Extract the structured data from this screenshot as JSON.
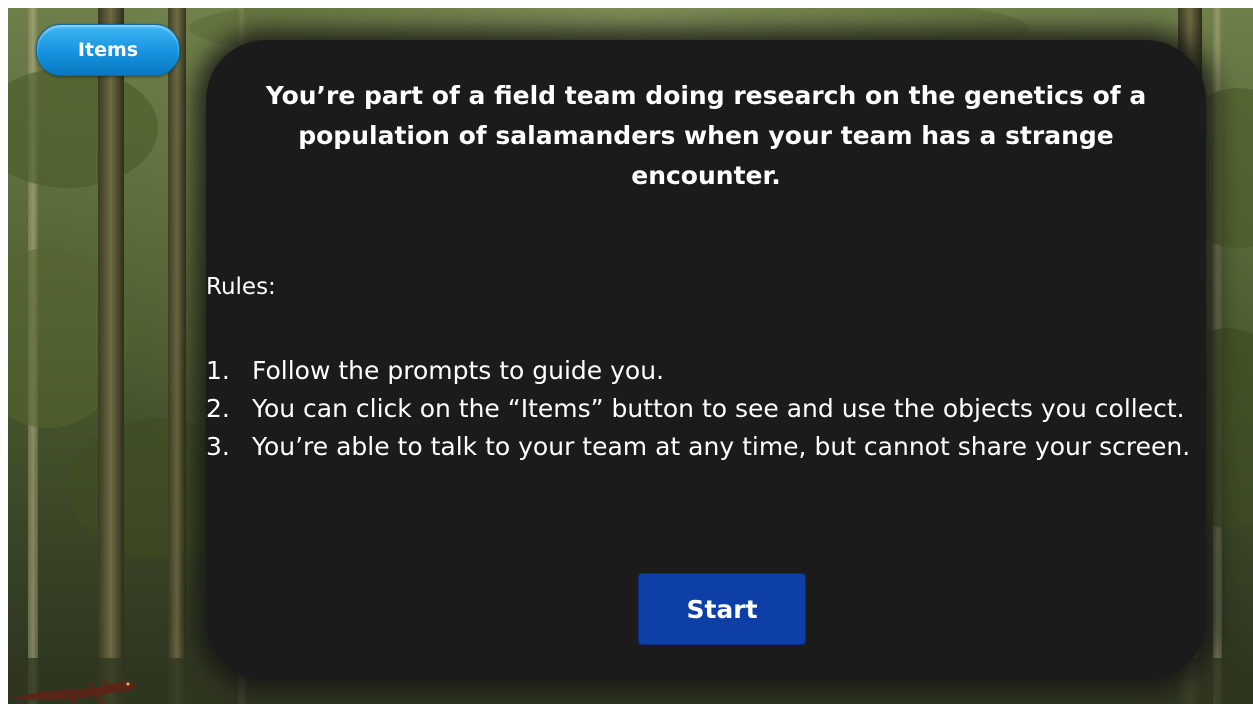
{
  "toolbar": {
    "items_label": "Items"
  },
  "dialog": {
    "intro_text": "You’re part of a field team doing research on the genetics of a population of salamanders when your team has a strange encounter.",
    "rules_heading": "Rules:",
    "rules": [
      {
        "number": "1.",
        "text": "Follow the prompts to guide you."
      },
      {
        "number": "2.",
        "text": "You can click on the “Items” button to see and use the objects you collect."
      },
      {
        "number": "3.",
        "text": "You’re able to talk to your team at any time, but cannot share your screen."
      }
    ],
    "start_label": "Start"
  },
  "colors": {
    "items_button": "#1593de",
    "start_button": "#0e3fa6",
    "panel_background": "#1b1b1b",
    "text": "#ffffff"
  },
  "icons": {
    "salamander": "salamander-icon"
  }
}
